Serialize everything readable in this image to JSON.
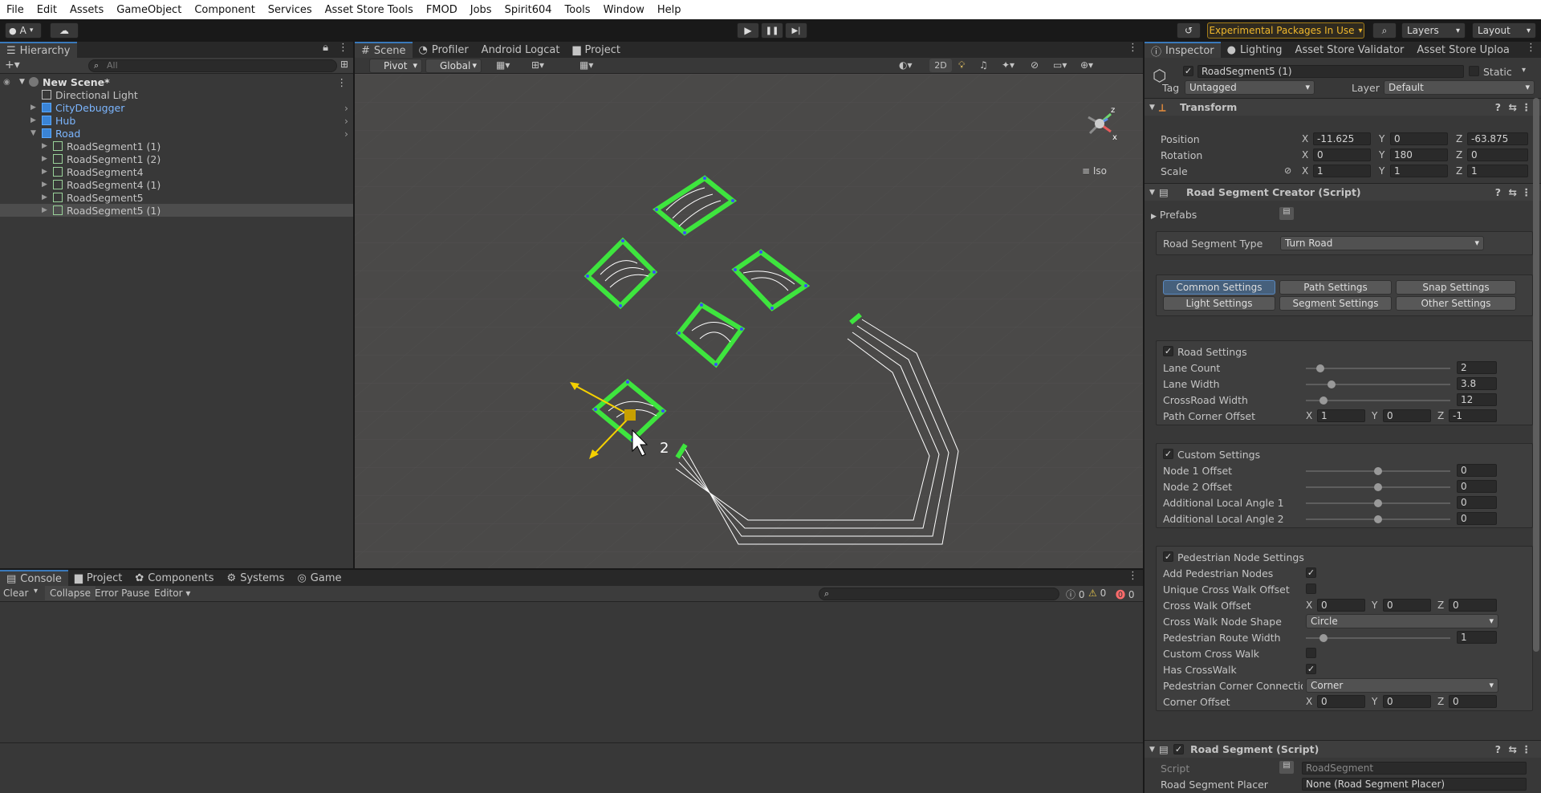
{
  "menu": [
    "File",
    "Edit",
    "Assets",
    "GameObject",
    "Component",
    "Services",
    "Asset Store Tools",
    "FMOD",
    "Jobs",
    "Spirit604",
    "Tools",
    "Window",
    "Help"
  ],
  "toolbar": {
    "account_label": "A",
    "experimental_label": "Experimental Packages In Use",
    "layers_label": "Layers",
    "layout_label": "Layout"
  },
  "hierarchy": {
    "tab": "Hierarchy",
    "search_placeholder": "All",
    "scene": "New Scene*",
    "items": [
      {
        "name": "Directional Light",
        "indent": 1
      },
      {
        "name": "CityDebugger",
        "indent": 1
      },
      {
        "name": "Hub",
        "indent": 1
      },
      {
        "name": "Road",
        "indent": 1
      },
      {
        "name": "RoadSegment1 (1)",
        "indent": 2
      },
      {
        "name": "RoadSegment1 (2)",
        "indent": 2
      },
      {
        "name": "RoadSegment4",
        "indent": 2
      },
      {
        "name": "RoadSegment4 (1)",
        "indent": 2
      },
      {
        "name": "RoadSegment5",
        "indent": 2
      },
      {
        "name": "RoadSegment5 (1)",
        "indent": 2
      }
    ]
  },
  "scene_tabs": [
    "Scene",
    "Profiler",
    "Android Logcat",
    "Project"
  ],
  "scene_toolbar": {
    "pivot": "Pivot",
    "global": "Global",
    "mode_2d": "2D",
    "iso": "Iso",
    "cursor_label": "2"
  },
  "console": {
    "tabs": [
      "Console",
      "Project",
      "Components",
      "Systems",
      "Game"
    ],
    "clear": "Clear",
    "collapse": "Collapse",
    "error_pause": "Error Pause",
    "editor": "Editor",
    "log_count": "0",
    "warn_count": "0",
    "error_count": "0"
  },
  "inspector": {
    "tabs": [
      "Inspector",
      "Lighting",
      "Asset Store Validator",
      "Asset Store Uploa"
    ],
    "object_name": "RoadSegment5 (1)",
    "static_label": "Static",
    "tag_label": "Tag",
    "tag_value": "Untagged",
    "layer_label": "Layer",
    "layer_value": "Default",
    "transform": {
      "title": "Transform",
      "position_label": "Position",
      "position": [
        "-11.625",
        "0",
        "-63.875"
      ],
      "rotation_label": "Rotation",
      "rotation": [
        "0",
        "180",
        "0"
      ],
      "scale_label": "Scale",
      "scale": [
        "1",
        "1",
        "1"
      ]
    },
    "creator": {
      "title": "Road Segment Creator (Script)",
      "prefabs_label": "Prefabs",
      "type_label": "Road Segment Type",
      "type_value": "Turn Road",
      "buttons": [
        "Common Settings",
        "Path Settings",
        "Snap Settings",
        "Light Settings",
        "Segment Settings",
        "Other Settings"
      ],
      "road": {
        "title": "Road Settings",
        "lane_count_label": "Lane Count",
        "lane_count": "2",
        "lane_count_frac": 0.1,
        "lane_width_label": "Lane Width",
        "lane_width": "3.8",
        "lane_width_frac": 0.18,
        "crossroad_width_label": "CrossRoad Width",
        "crossroad_width": "12",
        "crossroad_width_frac": 0.12,
        "path_corner_label": "Path Corner Offset",
        "path_corner": [
          "1",
          "0",
          "-1"
        ]
      },
      "custom": {
        "title": "Custom Settings",
        "node1_label": "Node 1 Offset",
        "node1": "0",
        "node1_frac": 0.5,
        "node2_label": "Node 2 Offset",
        "node2": "0",
        "node2_frac": 0.5,
        "angle1_label": "Additional Local Angle 1",
        "angle1": "0",
        "angle1_frac": 0.5,
        "angle2_label": "Additional Local Angle 2",
        "angle2": "0",
        "angle2_frac": 0.5
      },
      "pedestrian": {
        "title": "Pedestrian Node Settings",
        "add_nodes_label": "Add Pedestrian Nodes",
        "unique_offset_label": "Unique Cross Walk Offset",
        "cw_offset_label": "Cross Walk Offset",
        "cw_offset": [
          "0",
          "0",
          "0"
        ],
        "node_shape_label": "Cross Walk Node Shape",
        "node_shape": "Circle",
        "route_width_label": "Pedestrian Route Width",
        "route_width": "1",
        "route_width_frac": 0.12,
        "custom_cw_label": "Custom Cross Walk",
        "has_cw_label": "Has CrossWalk",
        "corner_conn_label": "Pedestrian Corner Connection",
        "corner_conn": "Corner",
        "corner_offset_label": "Corner Offset",
        "corner_offset": [
          "0",
          "0",
          "0"
        ]
      }
    },
    "segment": {
      "title": "Road Segment (Script)",
      "script_label": "Script",
      "script_value": "RoadSegment",
      "placer_label": "Road Segment Placer",
      "placer_value": "None (Road Segment Placer)"
    }
  }
}
